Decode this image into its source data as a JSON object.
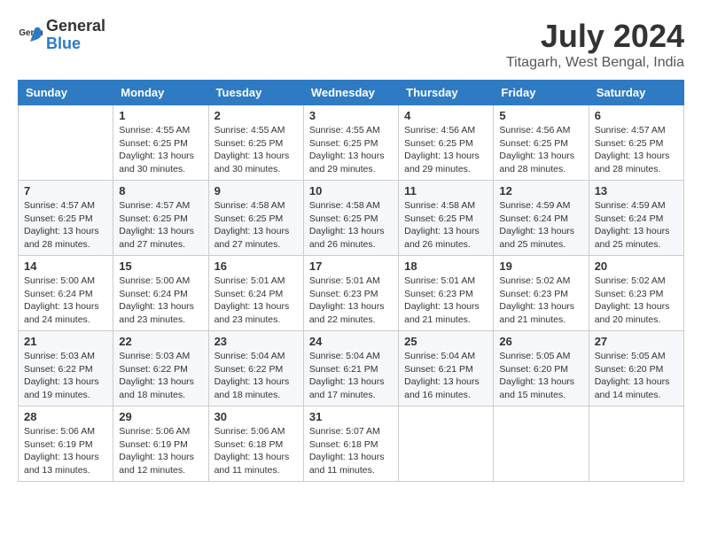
{
  "logo": {
    "general": "General",
    "blue": "Blue"
  },
  "header": {
    "month": "July 2024",
    "location": "Titagarh, West Bengal, India"
  },
  "weekdays": [
    "Sunday",
    "Monday",
    "Tuesday",
    "Wednesday",
    "Thursday",
    "Friday",
    "Saturday"
  ],
  "weeks": [
    [
      {
        "day": "",
        "sunrise": "",
        "sunset": "",
        "daylight": ""
      },
      {
        "day": "1",
        "sunrise": "Sunrise: 4:55 AM",
        "sunset": "Sunset: 6:25 PM",
        "daylight": "Daylight: 13 hours and 30 minutes."
      },
      {
        "day": "2",
        "sunrise": "Sunrise: 4:55 AM",
        "sunset": "Sunset: 6:25 PM",
        "daylight": "Daylight: 13 hours and 30 minutes."
      },
      {
        "day": "3",
        "sunrise": "Sunrise: 4:55 AM",
        "sunset": "Sunset: 6:25 PM",
        "daylight": "Daylight: 13 hours and 29 minutes."
      },
      {
        "day": "4",
        "sunrise": "Sunrise: 4:56 AM",
        "sunset": "Sunset: 6:25 PM",
        "daylight": "Daylight: 13 hours and 29 minutes."
      },
      {
        "day": "5",
        "sunrise": "Sunrise: 4:56 AM",
        "sunset": "Sunset: 6:25 PM",
        "daylight": "Daylight: 13 hours and 28 minutes."
      },
      {
        "day": "6",
        "sunrise": "Sunrise: 4:57 AM",
        "sunset": "Sunset: 6:25 PM",
        "daylight": "Daylight: 13 hours and 28 minutes."
      }
    ],
    [
      {
        "day": "7",
        "sunrise": "Sunrise: 4:57 AM",
        "sunset": "Sunset: 6:25 PM",
        "daylight": "Daylight: 13 hours and 28 minutes."
      },
      {
        "day": "8",
        "sunrise": "Sunrise: 4:57 AM",
        "sunset": "Sunset: 6:25 PM",
        "daylight": "Daylight: 13 hours and 27 minutes."
      },
      {
        "day": "9",
        "sunrise": "Sunrise: 4:58 AM",
        "sunset": "Sunset: 6:25 PM",
        "daylight": "Daylight: 13 hours and 27 minutes."
      },
      {
        "day": "10",
        "sunrise": "Sunrise: 4:58 AM",
        "sunset": "Sunset: 6:25 PM",
        "daylight": "Daylight: 13 hours and 26 minutes."
      },
      {
        "day": "11",
        "sunrise": "Sunrise: 4:58 AM",
        "sunset": "Sunset: 6:25 PM",
        "daylight": "Daylight: 13 hours and 26 minutes."
      },
      {
        "day": "12",
        "sunrise": "Sunrise: 4:59 AM",
        "sunset": "Sunset: 6:24 PM",
        "daylight": "Daylight: 13 hours and 25 minutes."
      },
      {
        "day": "13",
        "sunrise": "Sunrise: 4:59 AM",
        "sunset": "Sunset: 6:24 PM",
        "daylight": "Daylight: 13 hours and 25 minutes."
      }
    ],
    [
      {
        "day": "14",
        "sunrise": "Sunrise: 5:00 AM",
        "sunset": "Sunset: 6:24 PM",
        "daylight": "Daylight: 13 hours and 24 minutes."
      },
      {
        "day": "15",
        "sunrise": "Sunrise: 5:00 AM",
        "sunset": "Sunset: 6:24 PM",
        "daylight": "Daylight: 13 hours and 23 minutes."
      },
      {
        "day": "16",
        "sunrise": "Sunrise: 5:01 AM",
        "sunset": "Sunset: 6:24 PM",
        "daylight": "Daylight: 13 hours and 23 minutes."
      },
      {
        "day": "17",
        "sunrise": "Sunrise: 5:01 AM",
        "sunset": "Sunset: 6:23 PM",
        "daylight": "Daylight: 13 hours and 22 minutes."
      },
      {
        "day": "18",
        "sunrise": "Sunrise: 5:01 AM",
        "sunset": "Sunset: 6:23 PM",
        "daylight": "Daylight: 13 hours and 21 minutes."
      },
      {
        "day": "19",
        "sunrise": "Sunrise: 5:02 AM",
        "sunset": "Sunset: 6:23 PM",
        "daylight": "Daylight: 13 hours and 21 minutes."
      },
      {
        "day": "20",
        "sunrise": "Sunrise: 5:02 AM",
        "sunset": "Sunset: 6:23 PM",
        "daylight": "Daylight: 13 hours and 20 minutes."
      }
    ],
    [
      {
        "day": "21",
        "sunrise": "Sunrise: 5:03 AM",
        "sunset": "Sunset: 6:22 PM",
        "daylight": "Daylight: 13 hours and 19 minutes."
      },
      {
        "day": "22",
        "sunrise": "Sunrise: 5:03 AM",
        "sunset": "Sunset: 6:22 PM",
        "daylight": "Daylight: 13 hours and 18 minutes."
      },
      {
        "day": "23",
        "sunrise": "Sunrise: 5:04 AM",
        "sunset": "Sunset: 6:22 PM",
        "daylight": "Daylight: 13 hours and 18 minutes."
      },
      {
        "day": "24",
        "sunrise": "Sunrise: 5:04 AM",
        "sunset": "Sunset: 6:21 PM",
        "daylight": "Daylight: 13 hours and 17 minutes."
      },
      {
        "day": "25",
        "sunrise": "Sunrise: 5:04 AM",
        "sunset": "Sunset: 6:21 PM",
        "daylight": "Daylight: 13 hours and 16 minutes."
      },
      {
        "day": "26",
        "sunrise": "Sunrise: 5:05 AM",
        "sunset": "Sunset: 6:20 PM",
        "daylight": "Daylight: 13 hours and 15 minutes."
      },
      {
        "day": "27",
        "sunrise": "Sunrise: 5:05 AM",
        "sunset": "Sunset: 6:20 PM",
        "daylight": "Daylight: 13 hours and 14 minutes."
      }
    ],
    [
      {
        "day": "28",
        "sunrise": "Sunrise: 5:06 AM",
        "sunset": "Sunset: 6:19 PM",
        "daylight": "Daylight: 13 hours and 13 minutes."
      },
      {
        "day": "29",
        "sunrise": "Sunrise: 5:06 AM",
        "sunset": "Sunset: 6:19 PM",
        "daylight": "Daylight: 13 hours and 12 minutes."
      },
      {
        "day": "30",
        "sunrise": "Sunrise: 5:06 AM",
        "sunset": "Sunset: 6:18 PM",
        "daylight": "Daylight: 13 hours and 11 minutes."
      },
      {
        "day": "31",
        "sunrise": "Sunrise: 5:07 AM",
        "sunset": "Sunset: 6:18 PM",
        "daylight": "Daylight: 13 hours and 11 minutes."
      },
      {
        "day": "",
        "sunrise": "",
        "sunset": "",
        "daylight": ""
      },
      {
        "day": "",
        "sunrise": "",
        "sunset": "",
        "daylight": ""
      },
      {
        "day": "",
        "sunrise": "",
        "sunset": "",
        "daylight": ""
      }
    ]
  ]
}
